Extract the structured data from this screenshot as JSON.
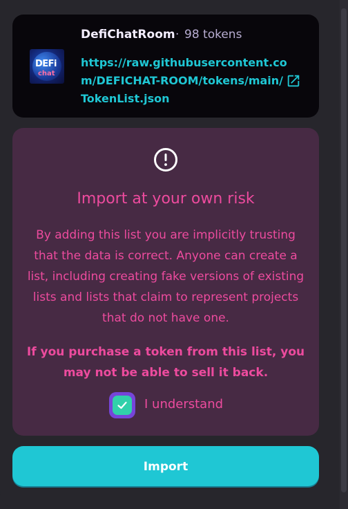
{
  "list": {
    "name": "DefiChatRoom",
    "separator": "·",
    "token_count": "98 tokens",
    "url": "https://raw.githubusercontent.com/DEFICHAT-ROOM/tokens/main/TokenList.json",
    "logo_text_line1": "DEFi",
    "logo_text_line2": "chat"
  },
  "warning": {
    "title": "Import at your own risk",
    "body": "By adding this list you are implicitly trusting that the data is correct. Anyone can create a list, including creating fake versions of existing lists and lists that claim to represent projects that do not have one.",
    "strong": "If you purchase a token from this list, you may not be able to sell it back.",
    "checkbox_label": "I understand",
    "checkbox_checked": true
  },
  "actions": {
    "import_label": "Import"
  },
  "colors": {
    "accent": "#1fc7d4",
    "failure": "#ed4b9e",
    "success": "#31d0aa",
    "secondary": "#7645d9",
    "card_bg": "#08060b",
    "warning_bg": "#472a44",
    "modal_bg": "#27262c"
  },
  "icons": {
    "warning": "alert-circle-icon",
    "external_link": "open-new-icon",
    "check": "check-icon"
  }
}
